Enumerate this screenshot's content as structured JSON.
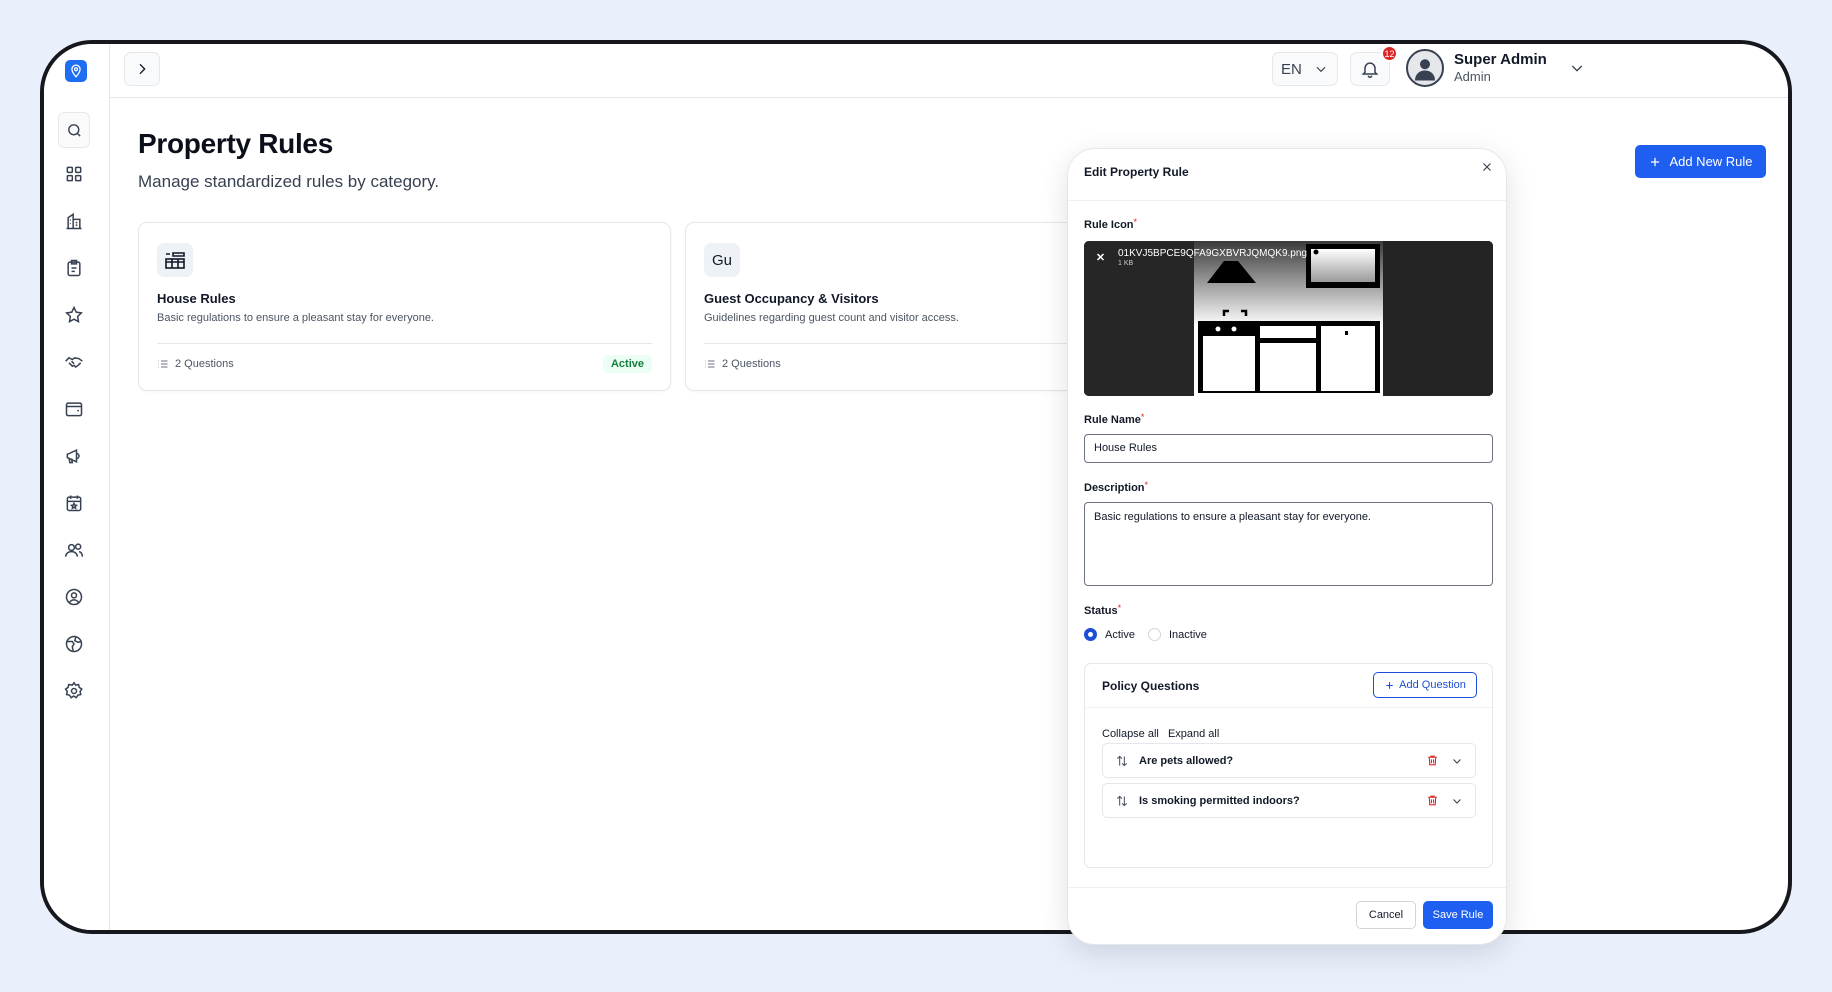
{
  "topbar": {
    "language": "EN",
    "notification_count": "12",
    "user_name": "Super Admin",
    "user_role": "Admin"
  },
  "sidebar": {
    "items": [
      {
        "icon": "dashboard-grid-icon"
      },
      {
        "icon": "buildings-icon"
      },
      {
        "icon": "clipboard-icon"
      },
      {
        "icon": "star-icon"
      },
      {
        "icon": "handshake-icon"
      },
      {
        "icon": "wallet-icon"
      },
      {
        "icon": "megaphone-icon"
      },
      {
        "icon": "calendar-star-icon"
      },
      {
        "icon": "users-icon"
      },
      {
        "icon": "user-circle-icon"
      },
      {
        "icon": "globe-icon"
      },
      {
        "icon": "settings-gear-icon"
      }
    ]
  },
  "page": {
    "title": "Property Rules",
    "subtitle": "Manage standardized rules by category.",
    "add_button": "Add New Rule"
  },
  "cards": [
    {
      "icon_text": "",
      "title": "House Rules",
      "description": "Basic regulations to ensure a pleasant stay for everyone.",
      "questions": "2 Questions",
      "status": "Active"
    },
    {
      "icon_text": "Gu",
      "title": "Guest Occupancy & Visitors",
      "description": "Guidelines regarding guest count and visitor access.",
      "questions": "2 Questions",
      "status": ""
    }
  ],
  "modal": {
    "title": "Edit Property Rule",
    "rule_icon_label": "Rule Icon",
    "file_name": "01KVJ5BPCE9QFA9GXBVRJQMQK9.png",
    "file_size": "1 KB",
    "rule_name_label": "Rule Name",
    "rule_name_value": "House Rules",
    "description_label": "Description",
    "description_value": "Basic regulations to ensure a pleasant stay for everyone.",
    "status_label": "Status",
    "status_options": [
      "Active",
      "Inactive"
    ],
    "status_selected": "Active",
    "required_mark": "*",
    "policy": {
      "title": "Policy Questions",
      "add_button": "Add Question",
      "collapse_all": "Collapse all",
      "expand_all": "Expand all",
      "questions": [
        "Are pets allowed?",
        "Is smoking permitted indoors?"
      ]
    },
    "cancel": "Cancel",
    "save": "Save Rule"
  },
  "colors": {
    "accent": "#1e5ff1",
    "danger": "#dc2626",
    "success": "#15803d",
    "background": "#e9effb"
  }
}
